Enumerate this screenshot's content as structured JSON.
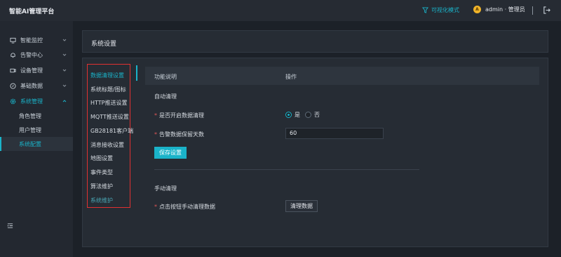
{
  "app": {
    "title": "智能AI管理平台"
  },
  "topbar": {
    "visual_mode": "可视化模式",
    "user_text": "admin · 管理员",
    "avatar_letter": "A"
  },
  "sidebar": {
    "items": [
      {
        "label": "智能监控",
        "icon": "monitor-icon"
      },
      {
        "label": "告警中心",
        "icon": "bell-icon"
      },
      {
        "label": "设备管理",
        "icon": "camera-icon"
      },
      {
        "label": "基础数据",
        "icon": "compass-icon"
      },
      {
        "label": "系统管理",
        "icon": "gear-icon"
      }
    ],
    "sub_items": [
      {
        "label": "角色管理"
      },
      {
        "label": "用户管理"
      },
      {
        "label": "系统配置"
      }
    ]
  },
  "page": {
    "title": "系统设置"
  },
  "tabs": [
    {
      "label": "数据清理设置"
    },
    {
      "label": "系统标题/图标"
    },
    {
      "label": "HTTP推送设置"
    },
    {
      "label": "MQTT推送设置"
    },
    {
      "label": "GB28181客户端"
    },
    {
      "label": "消息接收设置"
    },
    {
      "label": "地图设置"
    },
    {
      "label": "事件类型"
    },
    {
      "label": "算法维护"
    },
    {
      "label": "系统维护"
    }
  ],
  "table": {
    "col_desc": "功能说明",
    "col_op": "操作"
  },
  "auto": {
    "section": "自动清理",
    "enable_label": "是否开启数据清理",
    "yes": "是",
    "no": "否",
    "days_label": "告警数据保留天数",
    "days_value": "60",
    "save": "保存设置"
  },
  "manual": {
    "section": "手动清理",
    "label": "点击按钮手动清理数据",
    "button": "清理数据"
  },
  "colors": {
    "accent": "#1ab3c9",
    "required": "#e05757",
    "highlight_border": "#e03131"
  }
}
